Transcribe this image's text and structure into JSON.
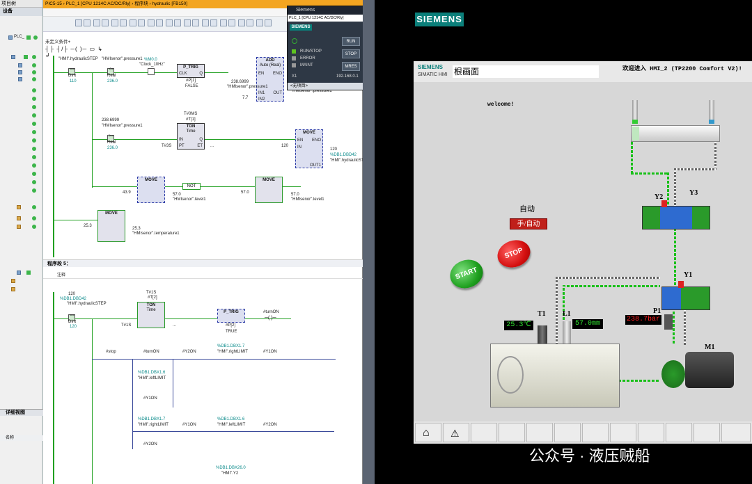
{
  "tree": {
    "header": "项目树",
    "tab": "设备",
    "root_item": "PLC_",
    "side_label": "详细视图",
    "name_col": "名称"
  },
  "editor": {
    "breadcrumb": "PIC5-15  ›  PLC_1 [CPU 1214C AC/DC/Rly]  ›  程序块  ›  hydraulic [FB150]",
    "condition": "未定义条件+",
    "network5_title": "程序段 5：",
    "comment": "注释",
    "net4": {
      "contacts": [
        {
          "var": "\"HMI\".hydraulicSTEP",
          "op": "==",
          "type": "DInt",
          "val": "110"
        },
        {
          "var": "\"HMIsenor\".pressure1",
          "op": "<=",
          "type": "Real",
          "val": "236.0"
        }
      ],
      "clock": {
        "addr": "%M0.0",
        "name": "\"Clock_10Hz\""
      },
      "ptrig": {
        "title": "P_TRIG",
        "clk": "CLK",
        "q": "Q",
        "inst": "#P[1]",
        "state": "FALSE"
      },
      "add": {
        "title": "ADD",
        "sub": "Auto (Real)",
        "en": "EN",
        "eno": "ENO",
        "in1": "IN1",
        "in2": "IN2",
        "out": "OUT",
        "in1_val": "238.6999",
        "in1_var": "\"HMIsenor\".pressure1",
        "in2_val": "7.7",
        "out_var": "\"HMIsenor\".pressure1"
      },
      "cmp2": {
        "val": "238.6999",
        "var": "\"HMIsenor\".pressure1",
        "op": ">=",
        "type": "Real",
        "limit": "236.0"
      },
      "ton": {
        "inst": "T#0MS",
        "db": "#T[1]",
        "title": "TON",
        "sub": "Time",
        "in": "IN",
        "pt": "PT",
        "q": "Q",
        "et": "ET",
        "pt_val": "T#3S",
        "et_val": "..."
      },
      "move1": {
        "title": "MOVE",
        "en": "EN",
        "eno": "ENO",
        "in": "IN",
        "out": "OUT1",
        "in_val": "120",
        "out_addr": "%DB1.DBD42",
        "out_var": "\"HMI\".hydraulicSTEP",
        "out_val": "120"
      },
      "move2": {
        "title": "MOVE",
        "in_val": "43.9",
        "out_val": "57.0",
        "out_var": "\"HMIsenor\".level1"
      },
      "not": "NOT",
      "move3": {
        "title": "MOVE",
        "in_val": "57.0",
        "out_val": "57.0",
        "out_var": "\"HMIsenor\".level1"
      },
      "move4": {
        "title": "MOVE",
        "in_val": "25.3",
        "out_val": "25.3",
        "out_var": "\"HMIsenor\".temperature1"
      }
    },
    "net5": {
      "cmp": {
        "val": "120",
        "addr": "%DB1.DBD42",
        "var": "\"HMI\".hydraulicSTEP",
        "op": "==",
        "type": "DInt",
        "limit": "120"
      },
      "ton": {
        "inst": "T#1S",
        "db": "#T[2]",
        "title": "TON",
        "sub": "Time",
        "pt_val": "T#1S",
        "et_val": "..."
      },
      "ptrig": {
        "title": "P_TRIG",
        "inst": "#P[2]",
        "state": "TRUE"
      },
      "coil_turnon": "#turnON",
      "row2": [
        "#stop",
        "#turnON",
        "#Y2ON",
        "\"HMI\".rightLIMIT",
        "#Y1ON"
      ],
      "row2_addr": "%DB1.DBX1.7",
      "left_addr": "%DB1.DBX1.6",
      "left_var": "\"HMI\".leftLIMIT",
      "y1on": "#Y1ON",
      "row4_addr1": "%DB1.DBX1.7",
      "row4_var1": "\"HMI\".rightLIMIT",
      "row4_y1": "#Y1ON",
      "row4_addr2": "%DB1.DBX1.6",
      "row4_var2": "\"HMI\".leftLIMIT",
      "row4_coil": "#Y2ON",
      "y2on": "#Y2ON",
      "bottom_addr": "%DB1.DBX26.0",
      "bottom_var": "\"HMI\".Y2"
    }
  },
  "plc_panel": {
    "title": "Siemens",
    "model": "PLC_1 [CPU 1214C AC/DC/Rly]",
    "brand": "SIEMENS",
    "run_btn": "RUN",
    "stop_btn": "STOP",
    "mres_btn": "MRES",
    "led1": "RUN/STOP",
    "led2": "ERROR",
    "led3": "MAINT",
    "x1": "X1",
    "ip": "192.168.0.1",
    "footer": "<无项目>"
  },
  "hmi": {
    "brand_top": "SIEMENS",
    "brand_small": "SIEMENS",
    "brand_sub": "SIMATIC HMI",
    "screen_name": "根画面",
    "welcome_cn": "欢迎进入 HMI_2 (TP2200 Comfort V2)!",
    "welcome": "welcome!",
    "mode_label": "自动",
    "mode_button": "手/自动",
    "stop_button": "STOP",
    "start_button": "START",
    "y1": "Y1",
    "y2": "Y2",
    "y3": "Y3",
    "t1": "T1",
    "l1": "L1",
    "p1": "P1",
    "m1": "M1",
    "temp": "25.3℃",
    "level": "57.0mm",
    "pressure": "238.7bar",
    "colors": {
      "green": "#18c018",
      "red": "#e01010",
      "teal": "#0b7f7a"
    }
  },
  "watermark": "公众号 · 液压贼船"
}
